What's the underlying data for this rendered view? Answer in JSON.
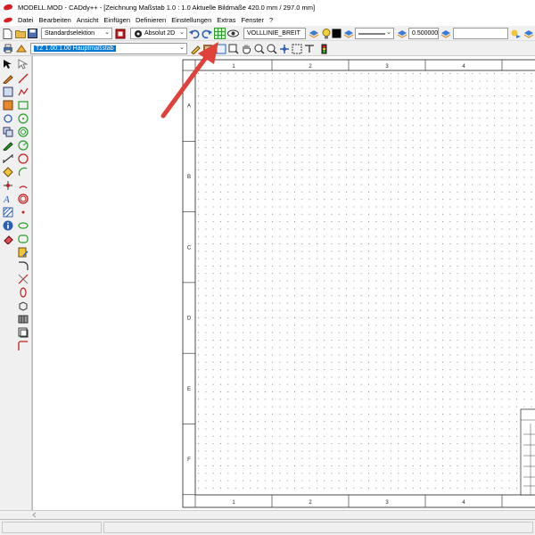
{
  "window": {
    "title": "MODELL.MOD  -  CADdy++ - [Zeichnung    Maßstab 1.0 : 1.0   Aktuelle Bildmaße 420.0 mm / 297.0 mm]"
  },
  "menu": {
    "items": [
      "Datei",
      "Bearbeiten",
      "Ansicht",
      "Einfügen",
      "Definieren",
      "Einstellungen",
      "Extras",
      "Fenster",
      "?"
    ]
  },
  "toolbar": {
    "selection_mode": "Standardselektion",
    "coordinate_mode": "Absolut 2D",
    "line_type": "VOLLLINIE_BREIT",
    "line_width": "0.500000",
    "line_width_extra": ""
  },
  "layer": {
    "current": "TZ 1.00:1.00 Hauptmaßstab"
  },
  "drawing": {
    "column_labels": [
      "1",
      "2",
      "3",
      "4"
    ],
    "row_labels": [
      "A",
      "B",
      "C",
      "D",
      "E",
      "F"
    ]
  },
  "colors": {
    "accent_red": "#d32020",
    "arrow": "#e0413a",
    "selection_blue": "#0078d7",
    "highlight_green": "#2a9d2a"
  }
}
